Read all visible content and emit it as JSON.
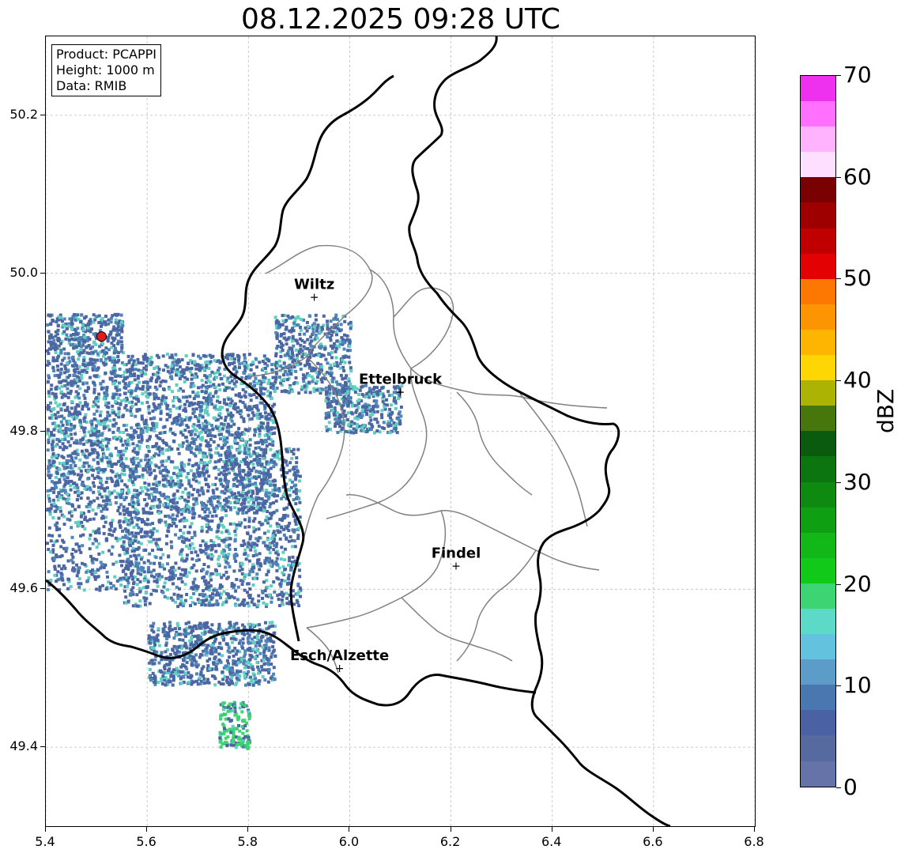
{
  "title": "08.12.2025 09:28 UTC",
  "info_box": {
    "product": "Product: PCAPPI",
    "height": "Height: 1000 m",
    "data": "Data: RMIB"
  },
  "axes": {
    "y_ticks": [
      "50.2",
      "50.0",
      "49.8",
      "49.6",
      "49.4"
    ],
    "x_ticks": [
      "5.4",
      "5.6",
      "5.8",
      "6.0",
      "6.2",
      "6.4",
      "6.6",
      "6.8"
    ],
    "lon_range": [
      5.4,
      6.8
    ],
    "lat_range": [
      49.3,
      50.3
    ],
    "grid": true
  },
  "cities": [
    {
      "name": "Wiltz",
      "lon": 5.93,
      "lat": 49.97
    },
    {
      "name": "Ettelbruck",
      "lon": 6.1,
      "lat": 49.85
    },
    {
      "name": "Findel",
      "lon": 6.21,
      "lat": 49.63
    },
    {
      "name": "Esch/Alzette",
      "lon": 5.98,
      "lat": 49.5
    }
  ],
  "radar_site": {
    "lon": 5.51,
    "lat": 49.92,
    "color": "#e41a1c"
  },
  "colorbar": {
    "unit": "dBZ",
    "labels": [
      "70",
      "60",
      "50",
      "40",
      "30",
      "20",
      "10",
      "0"
    ],
    "min": 0,
    "max": 70,
    "colors_bottom_to_top": [
      "#6573a8",
      "#566a9f",
      "#4a61a4",
      "#4b77b1",
      "#5b9dc8",
      "#63c2de",
      "#5dd9c7",
      "#3dd473",
      "#11c919",
      "#12b718",
      "#0f9f12",
      "#0d8a0f",
      "#0c7510",
      "#0b5b0f",
      "#47770c",
      "#acb304",
      "#fdd603",
      "#fdb502",
      "#fd9503",
      "#fd7703",
      "#e40104",
      "#c00000",
      "#9e0000",
      "#7a0101",
      "#ffdfff",
      "#ffb3ff",
      "#ff70ff",
      "#ee31ee"
    ]
  },
  "colors": {
    "echo_weak": "#4b66a3",
    "echo_mid": "#4e86b8",
    "echo_cyan": "#5ecfc0",
    "echo_green": "#3dd473",
    "border": "#000000",
    "canton": "#808080"
  }
}
